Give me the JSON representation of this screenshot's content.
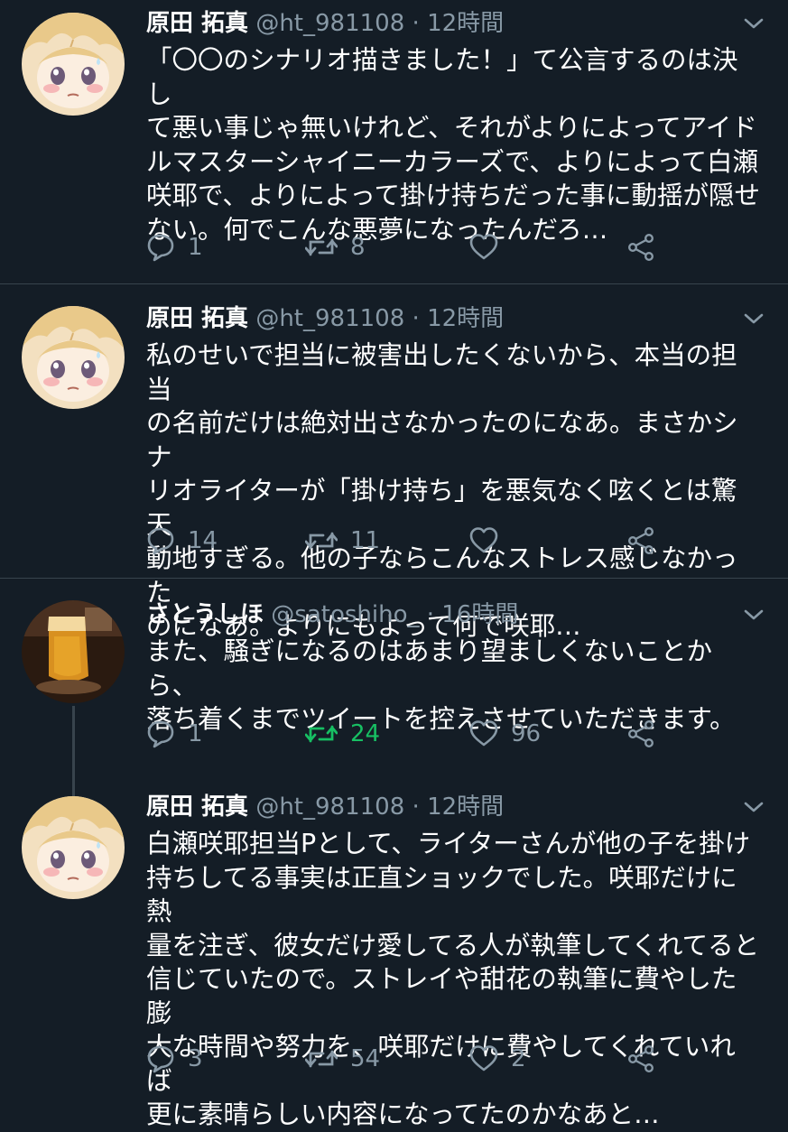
{
  "tweets": [
    {
      "name": "原田 拓真",
      "handle": "@ht_981108",
      "dot": "·",
      "time": "12時間",
      "lines": [
        "「〇〇のシナリオ描きました！」て公言するのは決し",
        "て悪い事じゃ無いけれど、それがよりによってアイド",
        "ルマスターシャイニーカラーズで、よりによって白瀬",
        "咲耶で、よりによって掛け持ちだった事に動揺が隠せ",
        "ない。何でこんな悪夢になったんだろ…"
      ],
      "replies": "1",
      "retweets": "8",
      "likes": "",
      "retweeted": false
    },
    {
      "name": "原田 拓真",
      "handle": "@ht_981108",
      "dot": "·",
      "time": "12時間",
      "lines": [
        "私のせいで担当に被害出したくないから、本当の担当",
        "の名前だけは絶対出さなかったのになあ。まさかシナ",
        "リオライターが「掛け持ち」を悪気なく呟くとは驚天",
        "動地すぎる。他の子ならこんなストレス感じなかった",
        "のになあ。よりにもよって何で咲耶…"
      ],
      "replies": "14",
      "retweets": "11",
      "likes": "",
      "retweeted": false
    },
    {
      "name": "さとうしほ",
      "handle": "@satoshiho_",
      "dot": "·",
      "time": "16時間",
      "lines": [
        "また、騒ぎになるのはあまり望ましくないことから、",
        "落ち着くまでツイートを控えさせていただきます。"
      ],
      "replies": "1",
      "retweets": "24",
      "likes": "96",
      "retweeted": true
    },
    {
      "name": "原田 拓真",
      "handle": "@ht_981108",
      "dot": "·",
      "time": "12時間",
      "lines": [
        "白瀬咲耶担当Pとして、ライターさんが他の子を掛け",
        "持ちしてる事実は正直ショックでした。咲耶だけに熱",
        "量を注ぎ、彼女だけ愛してる人が執筆してくれてると",
        "信じていたので。ストレイや甜花の執筆に費やした膨",
        "大な時間や努力を、咲耶だけに費やしてくれていれば",
        "更に素晴らしい内容になってたのかなあと…"
      ],
      "replies": "3",
      "retweets": "54",
      "likes": "2",
      "retweeted": false
    }
  ],
  "colors": {
    "background": "#141d26",
    "secondary_text": "#8899a6",
    "divider": "#38444d",
    "retweet_active": "#17bf63"
  },
  "icons": {
    "reply": "reply-icon",
    "retweet": "retweet-icon",
    "like": "heart-icon",
    "share": "share-icon",
    "menu": "chevron-down-icon"
  }
}
